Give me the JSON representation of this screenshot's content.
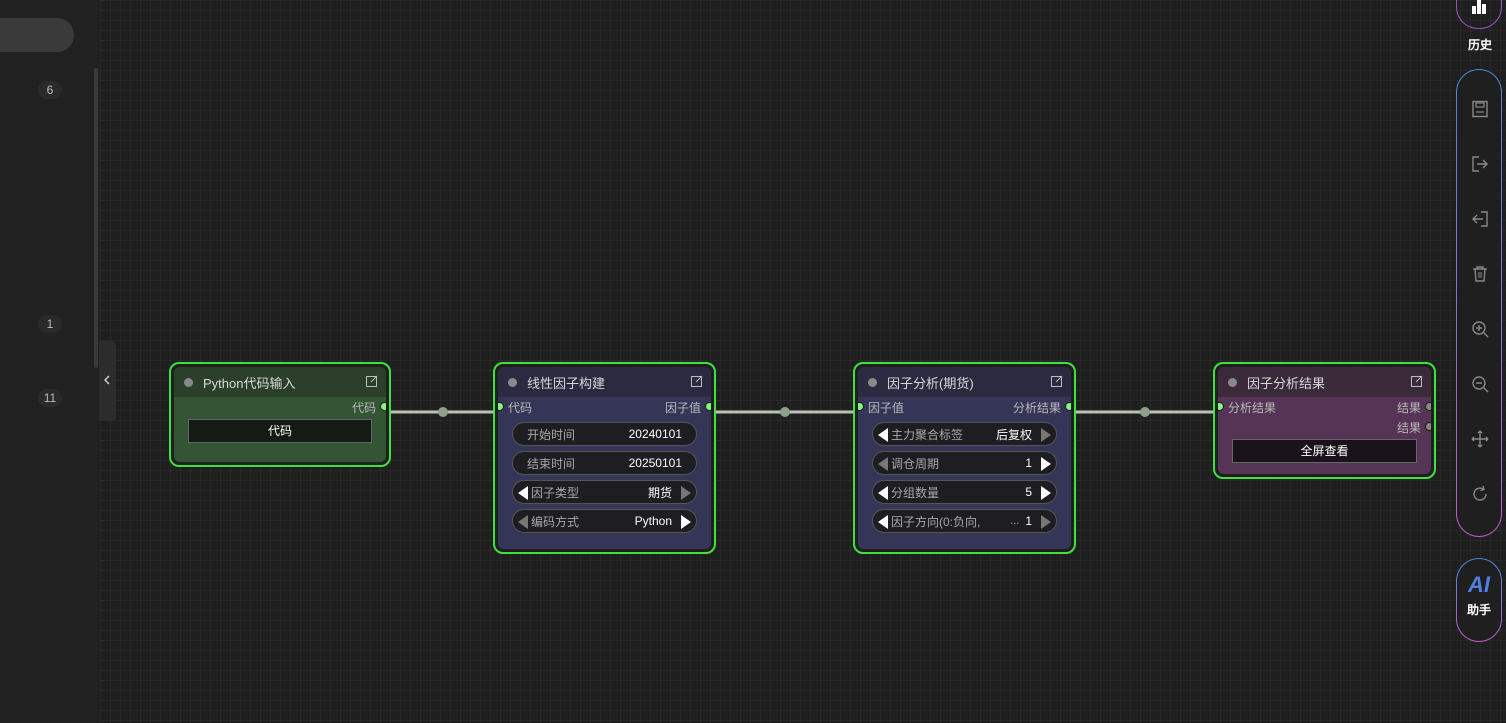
{
  "sidebar": {
    "line_numbers": [
      "6",
      "1",
      "11"
    ]
  },
  "nodes": {
    "python": {
      "title": "Python代码输入",
      "output_label": "代码",
      "button_label": "代码",
      "bg_color": "#345534"
    },
    "linear": {
      "title": "线性因子构建",
      "input_label": "代码",
      "output_label": "因子值",
      "fields": [
        {
          "label": "开始时间",
          "value": "20240101"
        },
        {
          "label": "结束时间",
          "value": "20250101"
        },
        {
          "label": "因子类型",
          "value": "期货"
        },
        {
          "label": "编码方式",
          "value": "Python"
        }
      ],
      "bg_color": "#353558"
    },
    "analysis": {
      "title": "因子分析(期货)",
      "input_label": "因子值",
      "output_label": "分析结果",
      "fields": [
        {
          "label": "主力聚合标签",
          "value": "后复权"
        },
        {
          "label": "调仓周期",
          "value": "1"
        },
        {
          "label": "分组数量",
          "value": "5"
        },
        {
          "label": "因子方向(0:负向,",
          "ellipsis": "...",
          "value": "1"
        }
      ],
      "bg_color": "#353558"
    },
    "result": {
      "title": "因子分析结果",
      "input_label": "分析结果",
      "outputs": [
        "结果",
        "结果"
      ],
      "button_label": "全屏查看",
      "bg_color": "#553455"
    }
  },
  "toolbar": {
    "history_label": "历史",
    "tools": [
      "save-icon",
      "export-icon",
      "import-icon",
      "trash-icon",
      "zoom-in-icon",
      "zoom-out-icon",
      "move-icon",
      "refresh-icon"
    ],
    "ai_logo": "AI",
    "ai_label": "助手"
  },
  "colors": {
    "node_border": "#3ee23e",
    "port_active": "#7cff7c",
    "toolbar_gradient_start": "#4a8ad8",
    "toolbar_gradient_end": "#c05ac8"
  }
}
